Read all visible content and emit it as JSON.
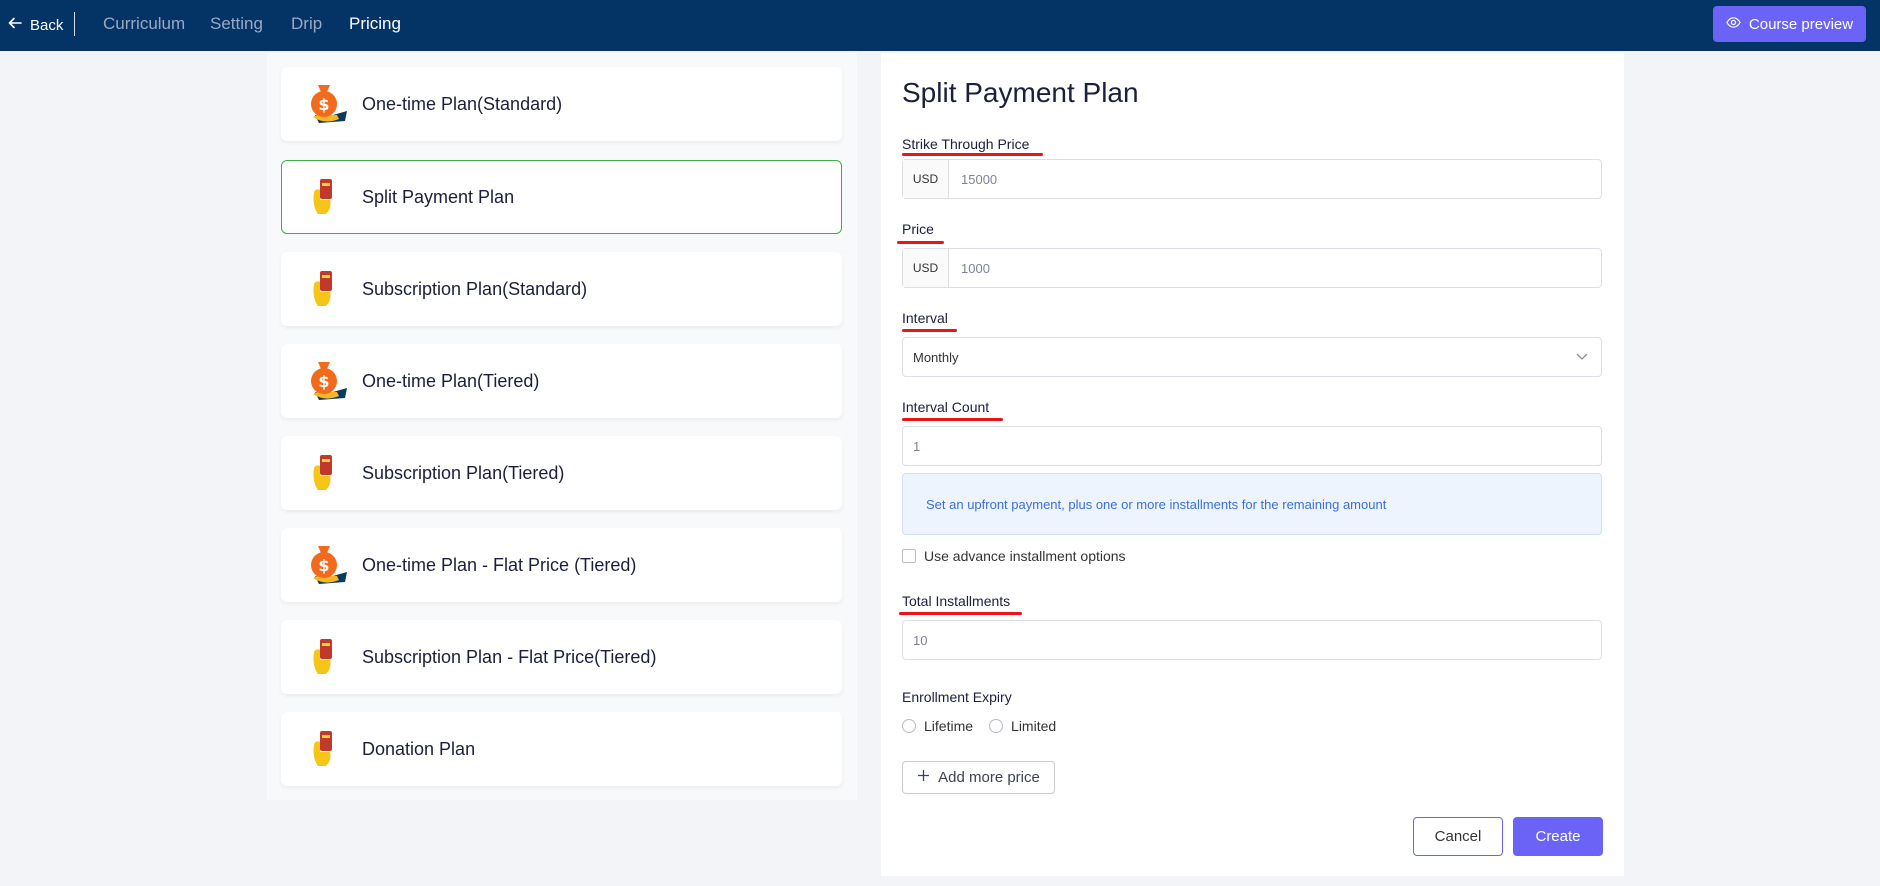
{
  "topbar": {
    "back_label": "Back",
    "nav": [
      "Curriculum",
      "Setting",
      "Drip",
      "Pricing"
    ],
    "active_nav": "Pricing",
    "preview_label": "Course preview"
  },
  "plans": [
    {
      "label": "One-time Plan(Standard)",
      "icon": "money-bag-icon"
    },
    {
      "label": "Split Payment Plan",
      "icon": "card-hand-icon"
    },
    {
      "label": "Subscription Plan(Standard)",
      "icon": "card-hand-icon"
    },
    {
      "label": "One-time Plan(Tiered)",
      "icon": "money-bag-icon"
    },
    {
      "label": "Subscription Plan(Tiered)",
      "icon": "card-hand-icon"
    },
    {
      "label": "One-time Plan - Flat Price (Tiered)",
      "icon": "money-bag-icon"
    },
    {
      "label": "Subscription Plan - Flat Price(Tiered)",
      "icon": "card-hand-icon"
    },
    {
      "label": "Donation Plan",
      "icon": "card-hand-icon"
    }
  ],
  "selected_plan": "Split Payment Plan",
  "form": {
    "title": "Split Payment Plan",
    "strike_label": "Strike Through Price",
    "strike_currency": "USD",
    "strike_value": "15000",
    "price_label": "Price",
    "price_currency": "USD",
    "price_value": "1000",
    "interval_label": "Interval",
    "interval_value": "Monthly",
    "interval_count_label": "Interval Count",
    "interval_count_value": "1",
    "info_text": "Set an upfront payment, plus one or more installments for the remaining amount",
    "advance_label": "Use advance installment options",
    "total_installments_label": "Total Installments",
    "total_installments_value": "10",
    "expiry_label": "Enrollment Expiry",
    "expiry_options": [
      "Lifetime",
      "Limited"
    ],
    "add_price_label": "Add more price",
    "cancel_label": "Cancel",
    "create_label": "Create"
  },
  "colors": {
    "topbar": "#043366",
    "accent": "#6a63f6",
    "selected_border": "#3cb043",
    "annotation_red": "#e8141a"
  }
}
